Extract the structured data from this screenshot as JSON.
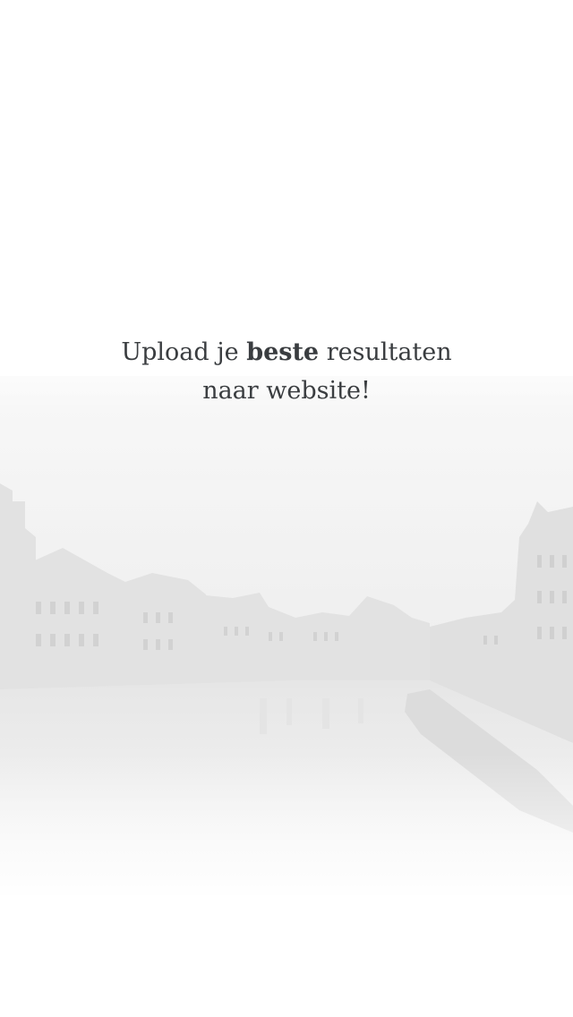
{
  "headline": {
    "line1_before": "Upload je",
    "line1_bold": "beste",
    "line1_after": "resultaten",
    "line2": "naar website!"
  },
  "background": {
    "icon": "city-canal-skyline-image",
    "colors": {
      "text": "#3a3d40",
      "page": "#ffffff"
    }
  }
}
